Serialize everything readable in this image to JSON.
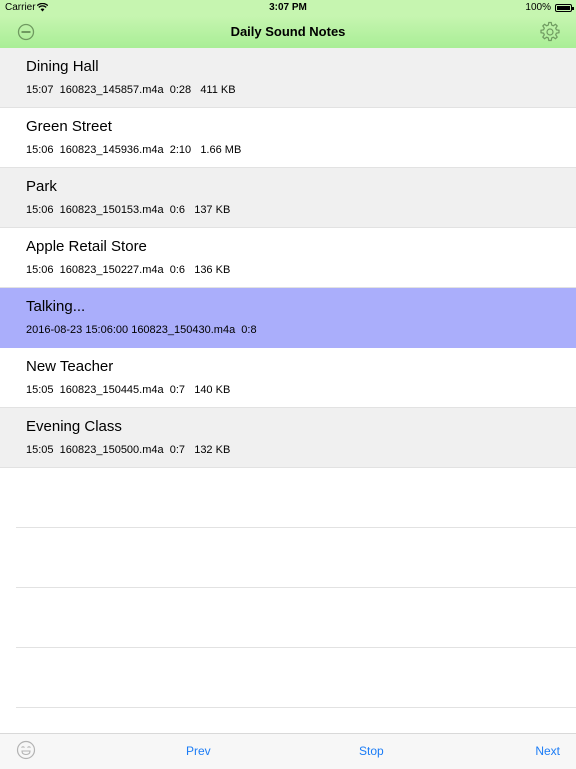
{
  "status_bar": {
    "carrier": "Carrier",
    "time": "3:07 PM",
    "battery": "100%"
  },
  "nav": {
    "title": "Daily Sound Notes",
    "left_icon": "minus-circle-icon",
    "right_icon": "gear-icon"
  },
  "notes": [
    {
      "title": "Dining Hall",
      "detail": "15:07  160823_145857.m4a  0:28   411 KB"
    },
    {
      "title": "Green Street",
      "detail": "15:06  160823_145936.m4a  2:10   1.66 MB"
    },
    {
      "title": "Park",
      "detail": "15:06  160823_150153.m4a  0:6   137 KB"
    },
    {
      "title": "Apple Retail Store",
      "detail": "15:06  160823_150227.m4a  0:6   136 KB"
    },
    {
      "title": "Talking...",
      "detail": "2016-08-23 15:06:00 160823_150430.m4a  0:8"
    },
    {
      "title": "New Teacher",
      "detail": "15:05  160823_150445.m4a  0:7   140 KB"
    },
    {
      "title": "Evening Class",
      "detail": "15:05  160823_150500.m4a  0:7   132 KB"
    }
  ],
  "active_index": 4,
  "toolbar": {
    "left_icon": "smiley-icon",
    "prev": "Prev",
    "stop": "Stop",
    "next": "Next"
  },
  "colors": {
    "nav_green": "#a9ee96",
    "active_row": "#aaaefb",
    "tint_blue": "#1b7cf6"
  }
}
